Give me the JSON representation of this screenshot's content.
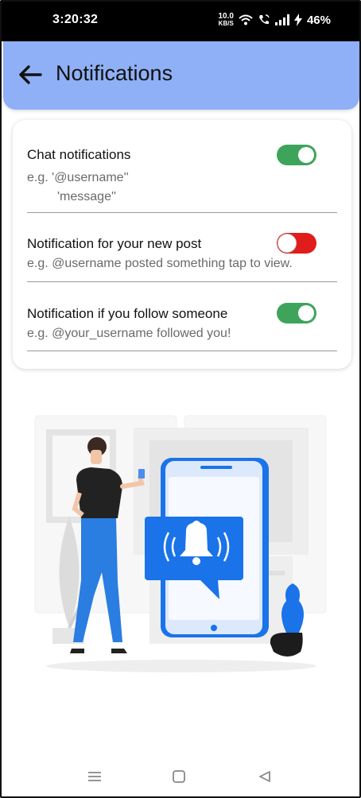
{
  "status_bar": {
    "time": "3:20:32",
    "net_speed_value": "10.0",
    "net_speed_unit": "KB/S",
    "battery_percent": "46%"
  },
  "header": {
    "title": "Notifications",
    "back_icon": "arrow-left-icon"
  },
  "settings": [
    {
      "title": "Chat notifications",
      "desc_line1": "e.g. '@username''",
      "desc_line2": "'message''",
      "enabled": true,
      "color": "#3ea45b"
    },
    {
      "title": "Notification for your new post",
      "desc_line1": "e.g. @username posted something tap to view.",
      "enabled": false,
      "color": "#e01c1c"
    },
    {
      "title": "Notification if you follow someone",
      "desc_line1": "e.g. @your_username followed you!",
      "enabled": true,
      "color": "#3ea45b"
    }
  ],
  "illustration": {
    "icon": "bell-notification-illustration",
    "accent": "#1a73e8"
  },
  "nav_bar": {
    "icons": [
      "menu-icon",
      "home-square-icon",
      "back-triangle-icon"
    ]
  }
}
